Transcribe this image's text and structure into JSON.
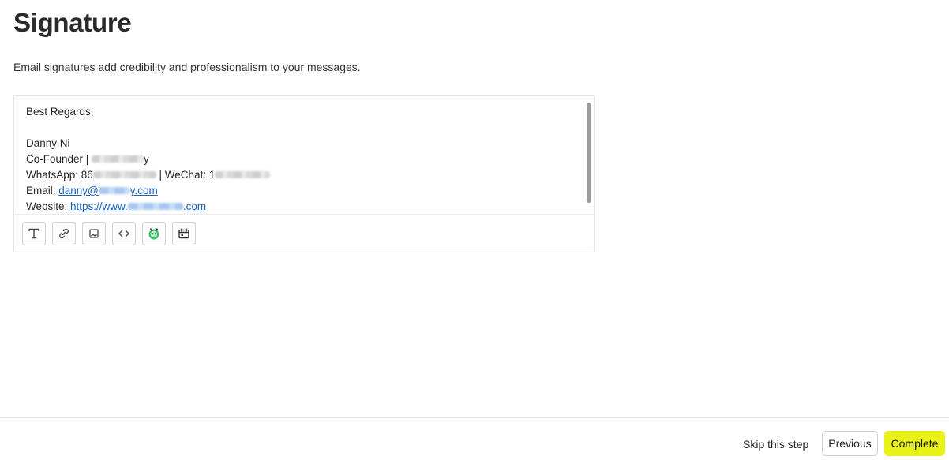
{
  "header": {
    "title": "Signature",
    "subtitle": "Email signatures add credibility and professionalism to your messages."
  },
  "signature": {
    "greeting": "Best Regards,",
    "name": "Danny Ni",
    "role_prefix": "Co-Founder | ",
    "role_suffix": "y",
    "whatsapp_prefix": "WhatsApp: 86",
    "wechat_label": " | WeChat: 1",
    "email_label": "Email: ",
    "email_start": "danny@",
    "email_end": "y.com",
    "website_label": "Website: ",
    "website_start": "https://www.",
    "website_end": ".com"
  },
  "toolbar": {
    "icons": [
      "text-format-icon",
      "link-icon",
      "image-icon",
      "code-icon",
      "bot-icon",
      "calendar-icon"
    ]
  },
  "footer": {
    "skip_label": "Skip this step",
    "previous_label": "Previous",
    "complete_label": "Complete"
  },
  "colors": {
    "accent": "#e8f216",
    "link": "#1a5fb4",
    "bot_green": "#35c46a"
  }
}
